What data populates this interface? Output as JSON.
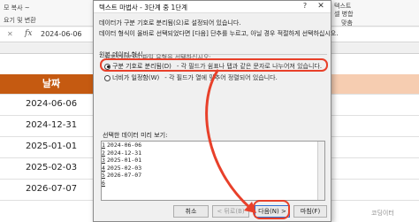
{
  "excel": {
    "ribbon_left_top": "모 복사 ~",
    "ribbon_left_bottom": "요기 및 변환",
    "ribbon_right_top": "텍스트",
    "ribbon_right_mid": "셀 병합",
    "ribbon_right_bottom": "맞춤",
    "formula_value": "2024-06-06",
    "header": "날짜",
    "dates": [
      "2024-06-06",
      "2024-12-31",
      "2025-01-01",
      "2025-02-03",
      "2026-07-07"
    ]
  },
  "dialog": {
    "title": "텍스트 마법사 - 3단계 중 1단계",
    "help": "?",
    "close": "✕",
    "line1": "데이터가 구분 기호로 분리됨(으)로 설정되어 있습니다.",
    "line2": "데이터 형식이 올바로 선택되었다면 [다음] 단추를 누르고, 아닐 경우 적절하게 선택하십시오.",
    "group_label": "원본 데이터 형식",
    "group_sub": "원본 데이터의 파일 유형을 선택하십시오:",
    "option1_label": "구분 기호로 분리됨(D)",
    "option1_desc": "- 각 필드가 쉼표나 탭과 같은 문자로 나누어져 있습니다.",
    "option2_label": "너비가 일정함(W)",
    "option2_desc": "- 각 필드가 열에 맞추어 정렬되어 있습니다.",
    "preview_label": "선택한 데이터 미리 보기:",
    "preview_rows": [
      {
        "n": "1",
        "text": "2024-06-06"
      },
      {
        "n": "2",
        "text": "2024-12-31"
      },
      {
        "n": "3",
        "text": "2025-01-01"
      },
      {
        "n": "4",
        "text": "2025-02-03"
      },
      {
        "n": "5",
        "text": "2026-07-07"
      },
      {
        "n": "6",
        "text": ""
      }
    ],
    "buttons": {
      "cancel": "취소",
      "back": "< 뒤로(B)",
      "next": "다음(N) >",
      "finish": "마침(F)"
    }
  },
  "watermark": "코딩이터",
  "colors": {
    "header_fill": "#c55a11",
    "annotation": "#e8402a"
  }
}
